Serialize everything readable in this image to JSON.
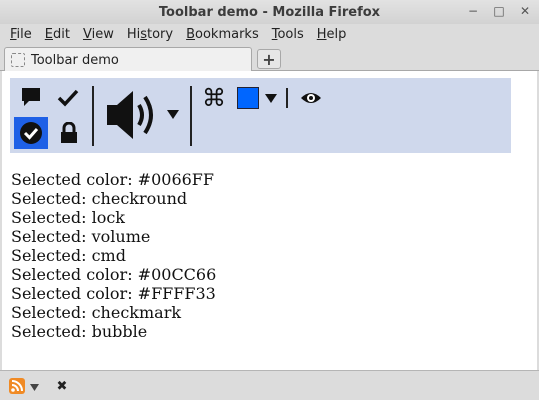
{
  "window": {
    "title": "Toolbar demo - Mozilla Firefox",
    "controls": [
      "−",
      "□",
      "✕"
    ]
  },
  "menubar": {
    "items": [
      {
        "label": "File",
        "accel": "F",
        "rest": "ile"
      },
      {
        "label": "Edit",
        "accel": "E",
        "rest": "dit"
      },
      {
        "label": "View",
        "accel": "V",
        "rest": "iew"
      },
      {
        "label": "History",
        "accel": "",
        "pre": "Hi",
        "mid": "s",
        "post": "tory"
      },
      {
        "label": "Bookmarks",
        "accel": "B",
        "rest": "ookmarks"
      },
      {
        "label": "Tools",
        "accel": "T",
        "rest": "ools"
      },
      {
        "label": "Help",
        "accel": "H",
        "rest": "elp"
      }
    ]
  },
  "tabs": [
    {
      "label": "Toolbar demo",
      "active": true
    }
  ],
  "new_tab_label": "+",
  "toolbar": {
    "background": "#cfd8ec",
    "selected_color": "#1e60e6",
    "color_swatch": "#0066FF",
    "icons": {
      "cmd_glyph": "⌘"
    }
  },
  "output": {
    "lines": [
      "Selected color: #0066FF",
      "Selected: checkround",
      "Selected: lock",
      "Selected: volume",
      "Selected: cmd",
      "Selected color: #00CC66",
      "Selected color: #FFFF33",
      "Selected: checkmark",
      "Selected: bubble"
    ]
  },
  "statusbar": {
    "close_glyph": "✖"
  }
}
